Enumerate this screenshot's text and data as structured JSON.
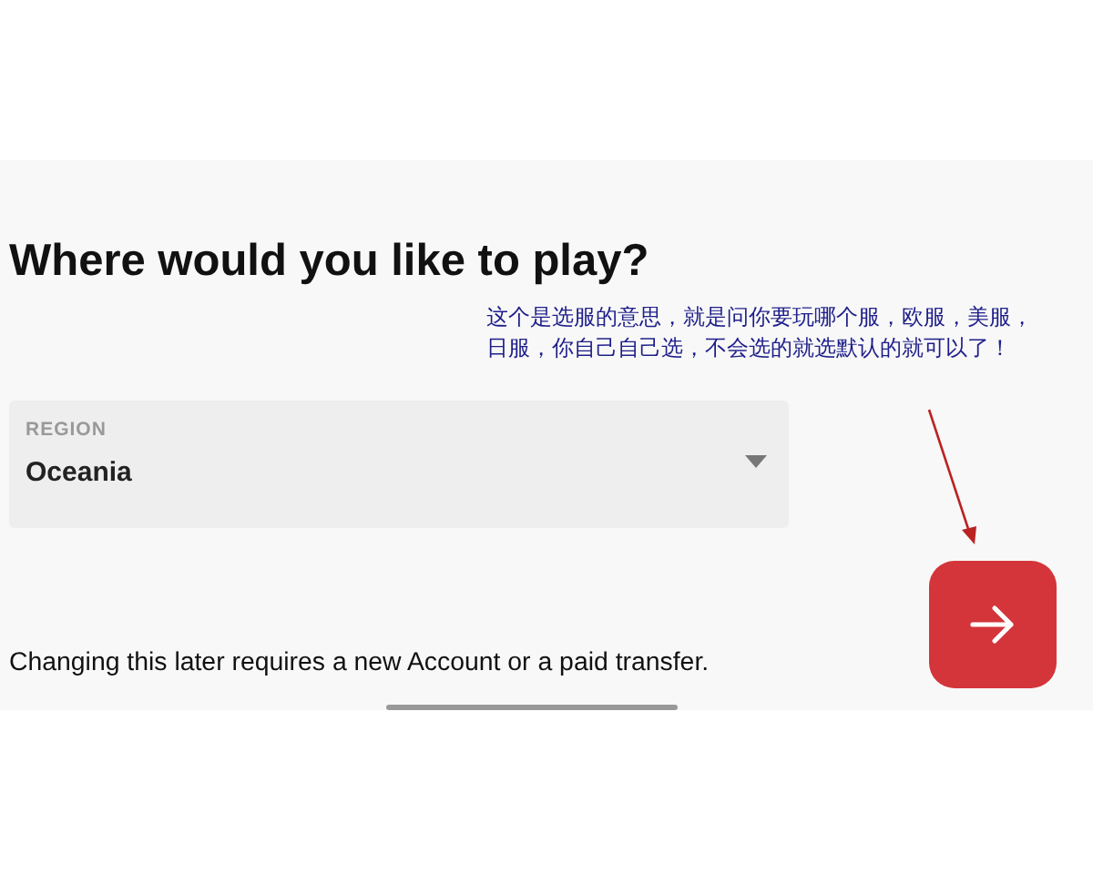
{
  "heading": "Where would you like to play?",
  "annotation": [
    "这个是选服的意思，就是问你要玩哪个服，欧服，美服，",
    "日服，你自己自己选，不会选的就选默认的就可以了！"
  ],
  "region_select": {
    "label": "REGION",
    "value": "Oceania"
  },
  "notice": "Changing this later requires a new Account or a paid transfer."
}
